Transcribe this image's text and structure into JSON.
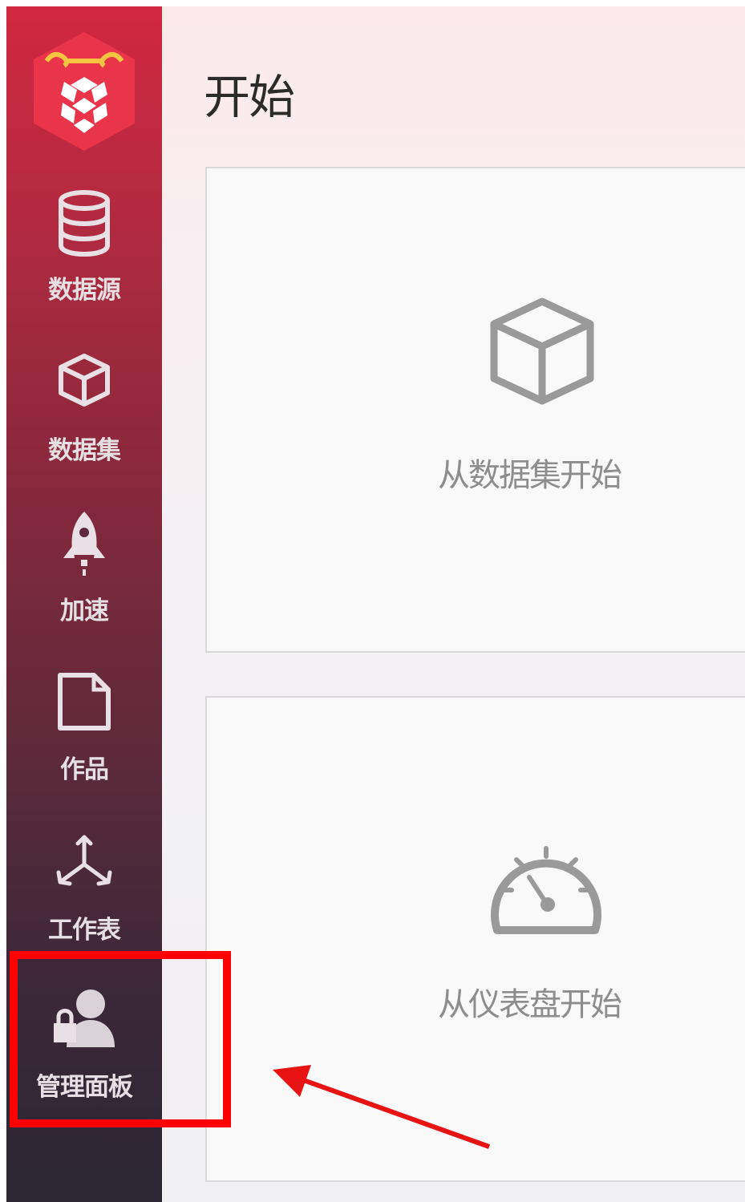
{
  "sidebar": {
    "logo": "logo-icon",
    "items": [
      {
        "label": "数据源",
        "icon": "database-icon"
      },
      {
        "label": "数据集",
        "icon": "cube-icon"
      },
      {
        "label": "加速",
        "icon": "rocket-icon"
      },
      {
        "label": "作品",
        "icon": "document-icon"
      },
      {
        "label": "工作表",
        "icon": "axes-icon"
      },
      {
        "label": "管理面板",
        "icon": "admin-user-lock-icon"
      }
    ]
  },
  "main": {
    "title": "开始",
    "cards": [
      {
        "label": "从数据集开始",
        "icon": "cube-icon"
      },
      {
        "label": "从仪表盘开始",
        "icon": "gauge-icon"
      }
    ]
  },
  "annotation": {
    "highlight_color": "#ff0000",
    "target": "管理面板"
  },
  "colors": {
    "sidebar_top": "#d1283f",
    "sidebar_bottom": "#2c2733",
    "title_text": "#2b2b2b",
    "card_text": "#8d8d8d"
  }
}
